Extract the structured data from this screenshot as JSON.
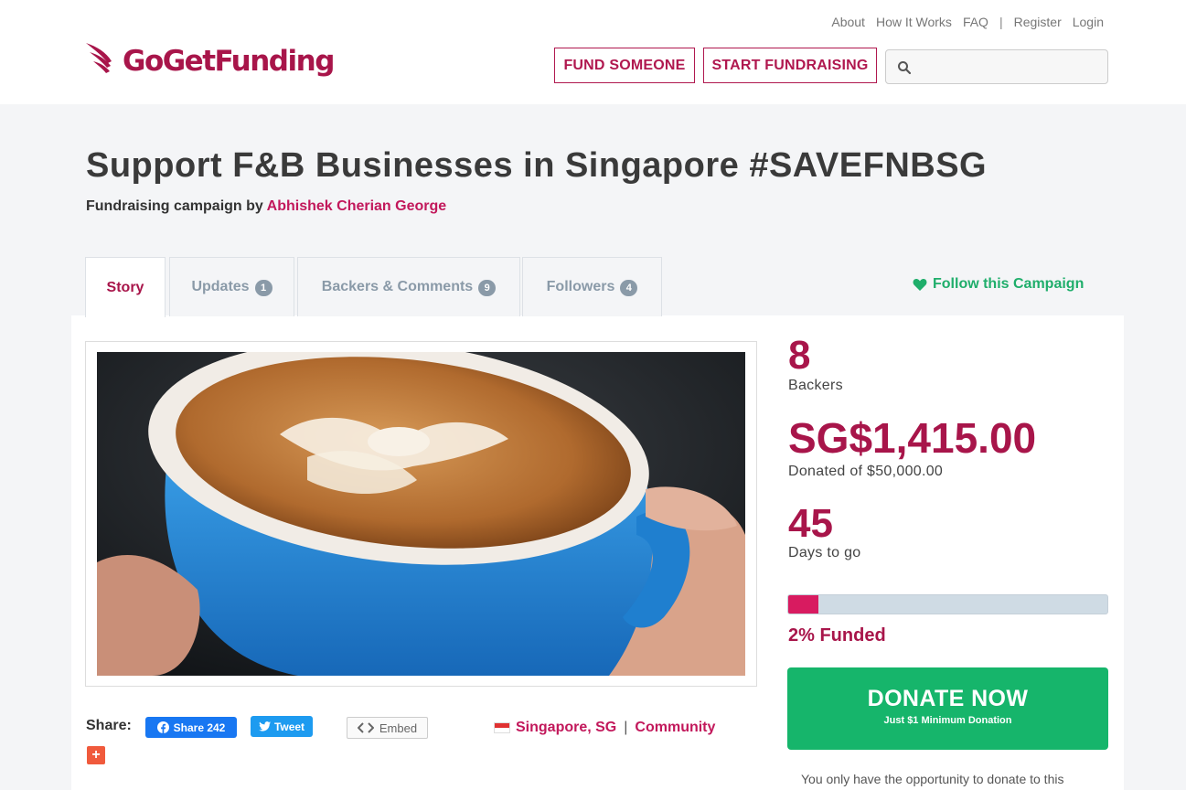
{
  "brand": {
    "name": "GoGetFunding",
    "color": "#a8154a"
  },
  "toplinks": [
    "About",
    "How It Works",
    "FAQ",
    "|",
    "Register",
    "Login"
  ],
  "nav": {
    "fund_label": "FUND SOMEONE",
    "start_label": "START FUNDRAISING",
    "search_placeholder": ""
  },
  "campaign": {
    "title": "Support F&B Businesses in Singapore #SAVEFNBSG",
    "byline_prefix": "Fundraising campaign by",
    "author": "Abhishek Cherian George"
  },
  "tabs": [
    {
      "label": "Story",
      "active": true
    },
    {
      "label": "Updates",
      "count": "1"
    },
    {
      "label": "Backers & Comments",
      "count": "9"
    },
    {
      "label": "Followers",
      "count": "4"
    }
  ],
  "follow_label": "Follow this Campaign",
  "image": {
    "alt": "latte-art-coffee-cup"
  },
  "share": {
    "label": "Share:",
    "facebook_label": "Share 242",
    "twitter_label": "Tweet",
    "embed_label": "Embed",
    "plus_label": "+"
  },
  "location": {
    "place": "Singapore, SG",
    "separator": "|",
    "category": "Community"
  },
  "stats": {
    "backers": "8",
    "backers_label": "Backers",
    "amount": "SG$1,415.00",
    "amount_label": "Donated of $50,000.00",
    "days": "45",
    "days_label": "Days to go",
    "funded_fraction": 0.0283,
    "funded_label": "2% Funded"
  },
  "donate": {
    "label": "DONATE NOW",
    "sublabel": "Just $1 Minimum Donation"
  },
  "footnote": "You only have the opportunity to donate to this",
  "colors": {
    "accent": "#a8154a",
    "green": "#16b56b",
    "facebook": "#1877f2",
    "twitter": "#1d9bf0"
  }
}
